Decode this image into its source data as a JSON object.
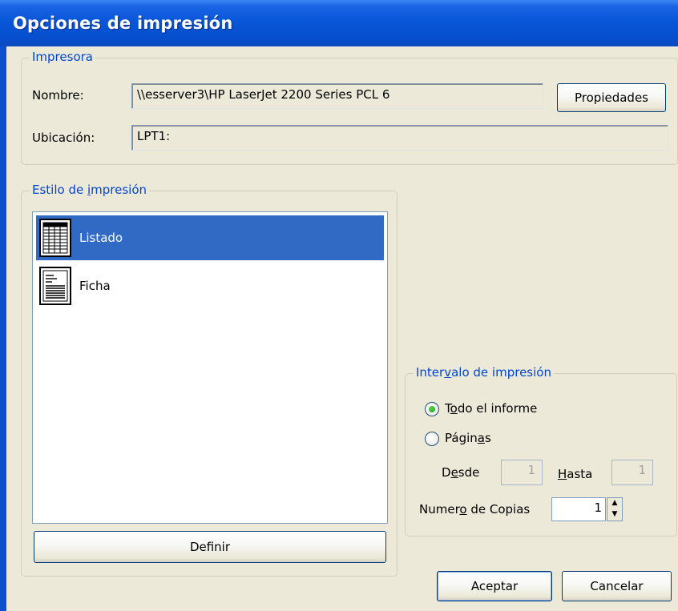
{
  "window": {
    "title": "Opciones de impresión"
  },
  "printer": {
    "group_label": "Impresora",
    "name_label": "Nombre:",
    "name_value": "\\\\esserver3\\HP LaserJet 2200 Series PCL 6",
    "properties_button": "Propiedades",
    "location_label": "Ubicación:",
    "location_value": "LPT1:"
  },
  "print_style": {
    "group_label_pre": "Estilo de ",
    "group_label_key": "i",
    "group_label_post": "mpresión",
    "items": [
      {
        "label": "Listado",
        "icon": "grid-list-icon",
        "selected": true
      },
      {
        "label": "Ficha",
        "icon": "record-card-icon",
        "selected": false
      }
    ],
    "define_button": "Definir"
  },
  "range": {
    "group_label_pre": "Inter",
    "group_label_key": "v",
    "group_label_post": "alo de impresión",
    "all_pre": "T",
    "all_key": "o",
    "all_post": "do el informe",
    "pages_pre": "Págin",
    "pages_key": "a",
    "pages_post": "s",
    "selected": "all",
    "from_pre": "D",
    "from_key": "e",
    "from_post": "sde",
    "from_value": "1",
    "to_key": "H",
    "to_post": "asta",
    "to_value": "1",
    "copies_pre": "Numer",
    "copies_key": "o",
    "copies_post": " de Copias",
    "copies_value": "1"
  },
  "buttons": {
    "ok": "Aceptar",
    "cancel": "Cancelar"
  }
}
